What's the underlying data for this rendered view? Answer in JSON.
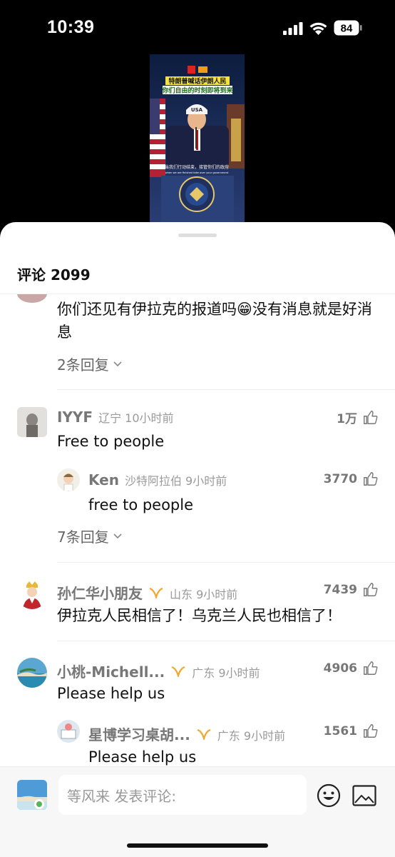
{
  "status": {
    "time": "10:39",
    "battery": "84"
  },
  "video": {
    "headline_line1": "特朗普喊话伊朗人民",
    "headline_line2": "你们自由的时刻即将到来",
    "subtitle_cn": "当我们行动结束，接管你们的政府",
    "subtitle_en": "when we are finished take over your government",
    "cap_text": "USA"
  },
  "comments_header": {
    "label": "评论",
    "count": "2099"
  },
  "comments": [
    {
      "text": "你们还见有伊拉克的报道吗😁没有消息就是好消息",
      "replies": "2条回复"
    },
    {
      "name": "IYYF",
      "location": "辽宁 10小时前",
      "likes": "1万",
      "text": "Free to people",
      "reply": {
        "name": "Ken",
        "location": "沙特阿拉伯 9小时前",
        "likes": "3770",
        "text": "free to people"
      },
      "replies": "7条回复"
    },
    {
      "name": "孙仁华小朋友",
      "location": "山东 9小时前",
      "likes": "7439",
      "text": "伊拉克人民相信了！乌克兰人民也相信了！"
    },
    {
      "name": "小桃-Michell...",
      "location": "广东 9小时前",
      "likes": "4906",
      "text": "Please help us",
      "reply": {
        "name": "星博学习桌胡...",
        "location": "广东 9小时前",
        "likes": "1561",
        "text": "Please help us"
      }
    }
  ],
  "composer": {
    "placeholder": "等风来 发表评论:"
  }
}
